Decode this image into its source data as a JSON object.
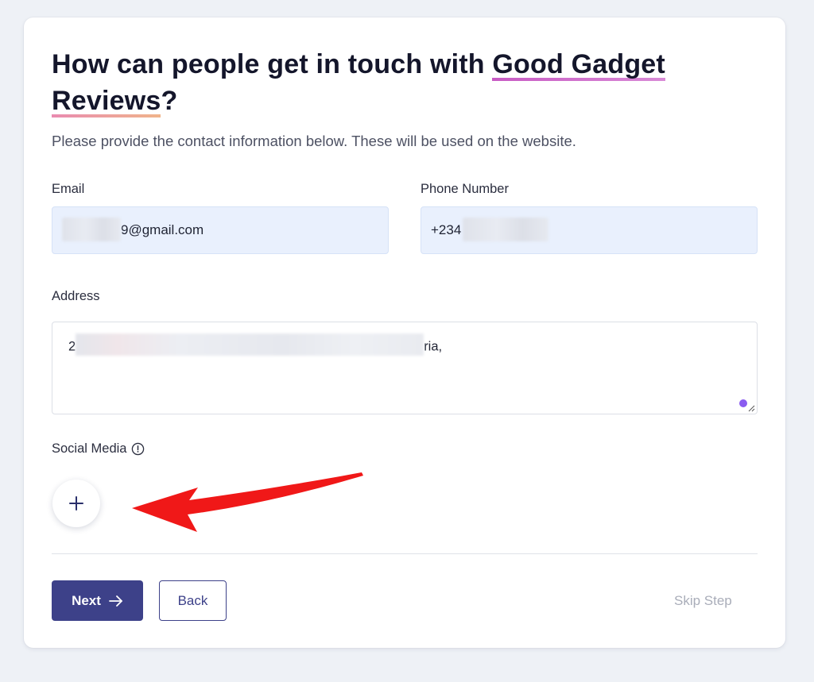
{
  "page": {
    "background": "#eef1f6",
    "accent": "#3d4189"
  },
  "heading": {
    "prefix": "How can people get in touch with ",
    "brand_part1": "Good Gadget",
    "brand_part2": "Reviews",
    "suffix": "?"
  },
  "subtitle": "Please provide the contact information below. These will be used on the website.",
  "form": {
    "email": {
      "label": "Email",
      "value_visible": "9@gmail.com"
    },
    "phone": {
      "label": "Phone Number",
      "value_visible": "+234"
    },
    "address": {
      "label": "Address",
      "value_start": "2",
      "value_end": "ria,"
    },
    "social": {
      "label": "Social Media",
      "info_icon": "info-circle-icon",
      "add_icon": "plus-icon"
    }
  },
  "annotation": {
    "arrow_color": "#f01818"
  },
  "buttons": {
    "next_label": "Next",
    "next_icon": "arrow-right-icon",
    "back_label": "Back",
    "skip_label": "Skip Step"
  }
}
